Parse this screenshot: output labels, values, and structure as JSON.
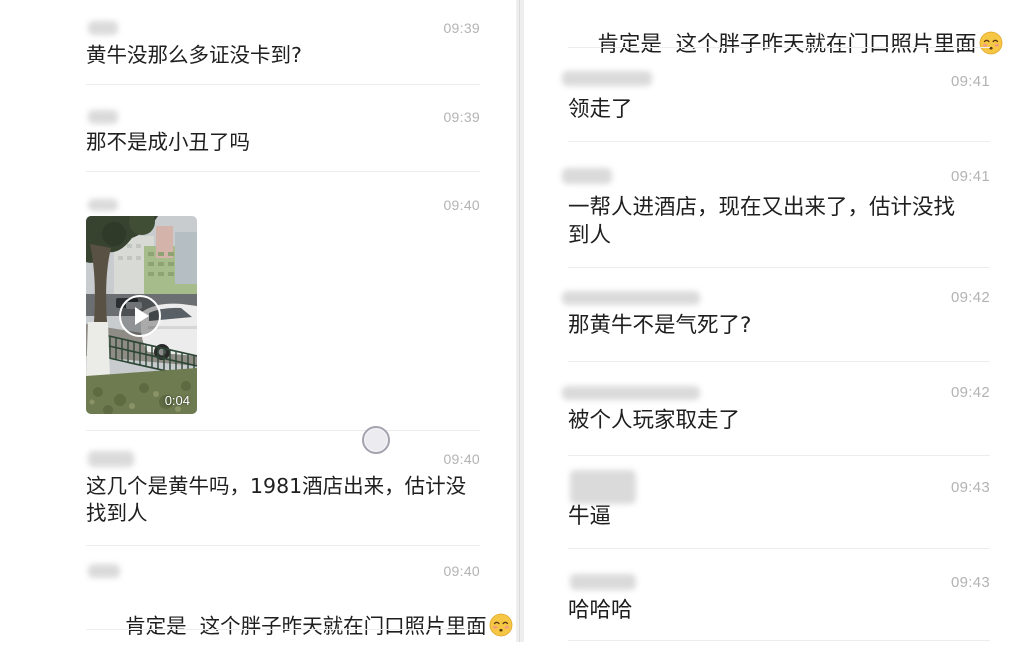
{
  "left_panel": {
    "messages": [
      {
        "time": "09:39",
        "text": "黄牛没那么多证没卡到?"
      },
      {
        "time": "09:39",
        "text": "那不是成小丑了吗"
      },
      {
        "time": "09:40",
        "video": {
          "duration": "0:04",
          "play_icon": "play-icon"
        }
      },
      {
        "time": "09:40",
        "text": "这几个是黄牛吗，1981酒店出来，估计没找到人"
      },
      {
        "time": "09:40",
        "text": "肯定是  这个胖子昨天就在门口照片里面",
        "emoji_icon": "kissing-face-closed-eyes-emoji"
      }
    ],
    "floating_button_icon": "assistive-touch-icon"
  },
  "right_panel": {
    "continued_message": {
      "text": "肯定是  这个胖子昨天就在门口照片里面",
      "emoji_icon": "kissing-face-closed-eyes-emoji"
    },
    "messages": [
      {
        "time": "09:41",
        "text": "领走了"
      },
      {
        "time": "09:41",
        "text": "一帮人进酒店，现在又出来了，估计没找到人"
      },
      {
        "time": "09:42",
        "text": "那黄牛不是气死了?"
      },
      {
        "time": "09:42",
        "text": "被个人玩家取走了"
      },
      {
        "time": "09:43",
        "text": "牛逼"
      },
      {
        "time": "09:43",
        "text": "哈哈哈"
      }
    ]
  },
  "colors": {
    "background": "#ffffff",
    "message_text": "#1f1f1f",
    "time_text": "#b3b3b3",
    "divider": "#ededed"
  }
}
